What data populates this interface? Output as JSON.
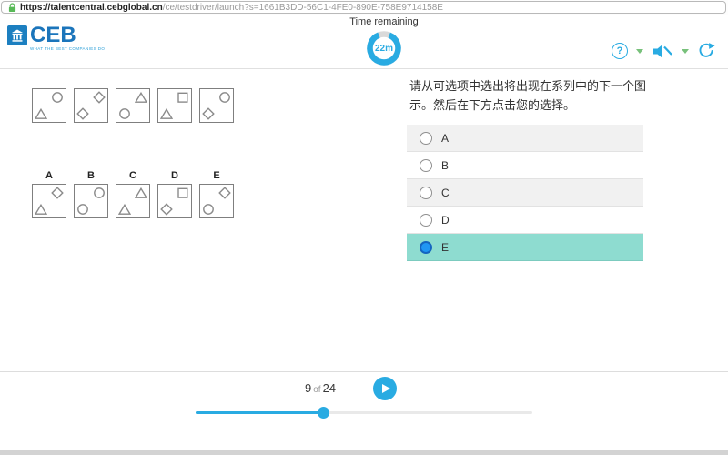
{
  "browser": {
    "url_secure": "https://talentcentral.cebglobal.cn",
    "url_path": "/ce/testdriver/launch?s=1661B3DD-56C1-4FE0-890E-758E9714158E"
  },
  "header": {
    "logo": {
      "text": "CEB",
      "tagline": "WHAT THE BEST COMPANIES DO"
    },
    "timer": {
      "label": "Time remaining",
      "value": "22m",
      "fraction_remaining": 0.88
    },
    "icons": [
      "help-icon",
      "dropdown-caret",
      "audio-muted-icon",
      "dropdown-caret",
      "refresh-icon"
    ]
  },
  "question": {
    "instruction": "请从可选项中选出将出现在系列中的下一个图示。然后在下方点击您的选择。",
    "series_boxes": [
      {
        "top_right": "circle",
        "bottom_left": "triangle"
      },
      {
        "top_right": "diamond",
        "bottom_left": "diamond"
      },
      {
        "top_right": "triangle",
        "bottom_left": "circle"
      },
      {
        "top_right": "square",
        "bottom_left": "triangle"
      },
      {
        "top_right": "circle",
        "bottom_left": "diamond"
      }
    ],
    "option_boxes": [
      {
        "label": "A",
        "top_right": "diamond",
        "bottom_left": "triangle"
      },
      {
        "label": "B",
        "top_right": "circle",
        "bottom_left": "circle"
      },
      {
        "label": "C",
        "top_right": "triangle",
        "bottom_left": "triangle"
      },
      {
        "label": "D",
        "top_right": "square",
        "bottom_left": "diamond"
      },
      {
        "label": "E",
        "top_right": "diamond",
        "bottom_left": "circle"
      }
    ],
    "choices": [
      {
        "label": "A",
        "selected": false
      },
      {
        "label": "B",
        "selected": false
      },
      {
        "label": "C",
        "selected": false
      },
      {
        "label": "D",
        "selected": false
      },
      {
        "label": "E",
        "selected": true
      }
    ]
  },
  "footer": {
    "current": "9",
    "of_label": "of",
    "total": "24",
    "progress_fraction": 0.378
  },
  "colors": {
    "accent_blue": "#29abe2",
    "selected_teal": "#8edcd0",
    "radio_selected_fill": "#2196f3",
    "caret_green": "#78c17b",
    "lock_green": "#58b957",
    "logo_blue": "#1b75bb"
  }
}
